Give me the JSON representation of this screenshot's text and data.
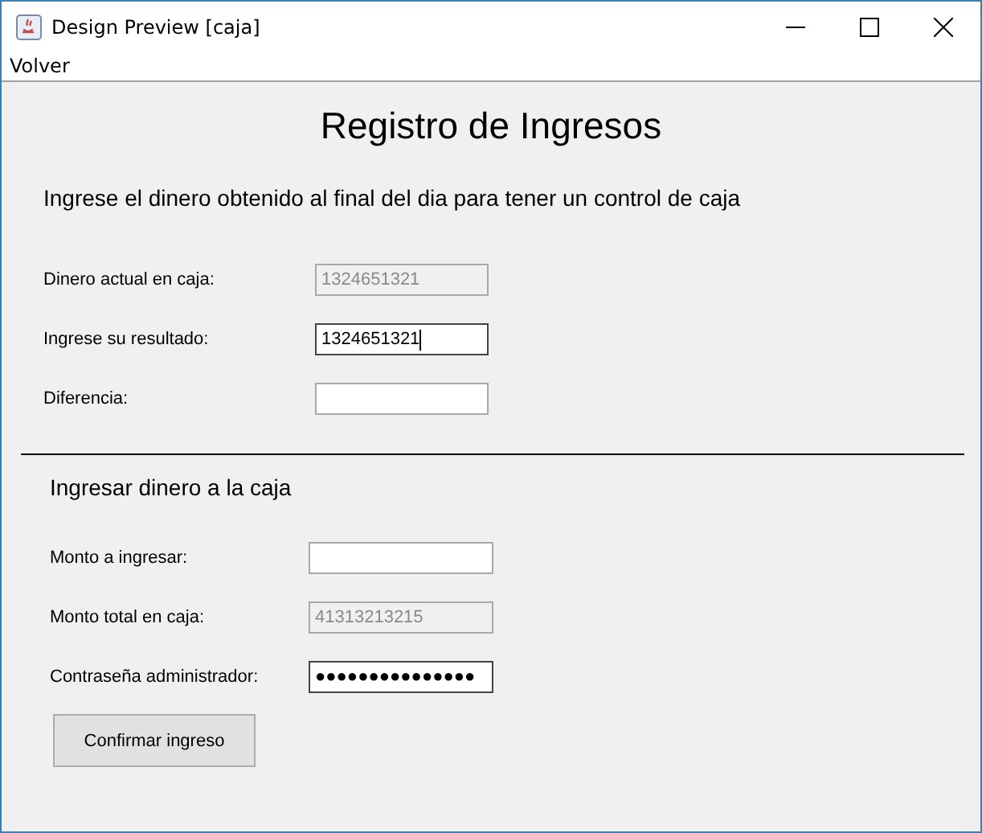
{
  "window": {
    "title": "Design Preview [caja]"
  },
  "menu": [
    "Volver"
  ],
  "heading": "Registro de Ingresos",
  "intro": "Ingrese el dinero obtenido al final del dia para tener un control de caja",
  "check_fields": [
    {
      "label": "Dinero actual en caja:",
      "value": "1324651321",
      "disabled": true,
      "focused": false
    },
    {
      "label": "Ingrese su resultado:",
      "value": "1324651321",
      "disabled": false,
      "focused": true
    },
    {
      "label": "Diferencia:",
      "disabled": false,
      "focused": false
    }
  ],
  "deposit_section": {
    "title": "Ingresar dinero a la caja",
    "fields": [
      {
        "label": "Monto a ingresar:",
        "disabled": false,
        "focused": false
      },
      {
        "label": "Monto total en caja:",
        "value": "41313213215",
        "disabled": true,
        "focused": false
      },
      {
        "label": "Contraseña administrador:",
        "value": "●●●●●●●●●●●●●●●",
        "disabled": false,
        "focused": true
      }
    ],
    "button": "Confirmar ingreso"
  }
}
